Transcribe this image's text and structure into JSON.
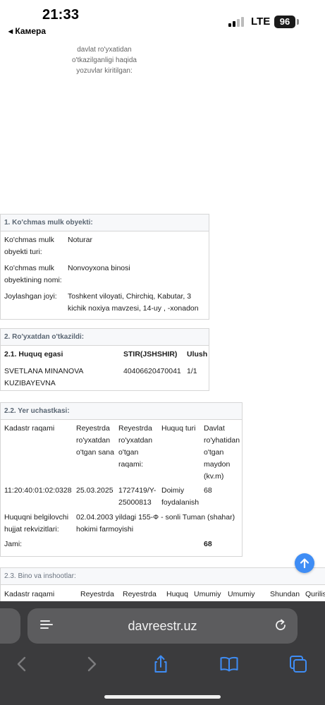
{
  "status_bar": {
    "time": "21:33",
    "back_app": "◂ Камера",
    "network": "LTE",
    "battery": "96"
  },
  "intro_note": "davlat ro'yxatidan o'tkazilganligi haqida yozuvlar kiritilgan:",
  "section1": {
    "title": "1. Ko'chmas mulk obyekti:",
    "rows": [
      {
        "label": "Ko'chmas mulk obyekti turi:",
        "value": "Noturar"
      },
      {
        "label": "Ko'chmas mulk obyektining nomi:",
        "value": "Nonvoyxona binosi"
      },
      {
        "label": "Joylashgan joyi:",
        "value": "Toshkent viloyati, Chirchiq, Kabutar, 3 kichik noxiya mavzesi, 14-uy , -xonadon"
      }
    ]
  },
  "section2": {
    "title": "2. Ro'yxatdan o'tkazildi:",
    "headers": [
      "2.1. Huquq egasi",
      "STIR(JSHSHIR)",
      "Ulush"
    ],
    "rows": [
      {
        "owner": "SVETLANA MINANOVA KUZIBAYEVNA",
        "stir": "40406620470041",
        "share": "1/1"
      }
    ]
  },
  "section22": {
    "title": "2.2. Yer uchastkasi:",
    "headers": [
      "Kadastr raqami",
      "Reyestrda ro'yxatdan o'tgan sana",
      "Reyestrda ro'yxatdan o'tgan raqami:",
      "Huquq turi",
      "Davlat ro'yhatidan o'tgan maydon (kv.m)"
    ],
    "row": {
      "cadastre": "11:20:40:01:02:0328",
      "date": "25.03.2025",
      "number": "1727419/Y-25000813",
      "right_type": "Doimiy foydalanish",
      "area": "68"
    },
    "basis_label": "Huquqni belgilovchi hujjat rekvizitlari:",
    "basis_value": "02.04.2003 yildagi 155-Ф - sonli Tuman (shahar) hokimi farmoyishi",
    "total_label": "Jami:",
    "total_value": "68"
  },
  "section23": {
    "title": "2.3. Bino va inshootlar:",
    "headers": [
      "Kadastr raqami",
      "Reyestrda",
      "Reyestrda",
      "Huquq",
      "Umumiy",
      "Umumiy",
      "Shundan",
      "Qurilis"
    ]
  },
  "browser": {
    "url": "davreestr.uz"
  },
  "icons": {
    "reader": "reader-mode-icon",
    "reload": "reload-icon",
    "back": "chevron-left-icon",
    "forward": "chevron-right-icon",
    "share": "share-icon",
    "bookmarks": "book-icon",
    "tabs": "tabs-icon",
    "scroll_top": "arrow-up-icon"
  },
  "colors": {
    "accent": "#3f8df5",
    "section_header_text": "#5a6673",
    "toolbar_bg": "#3b3b3d"
  }
}
